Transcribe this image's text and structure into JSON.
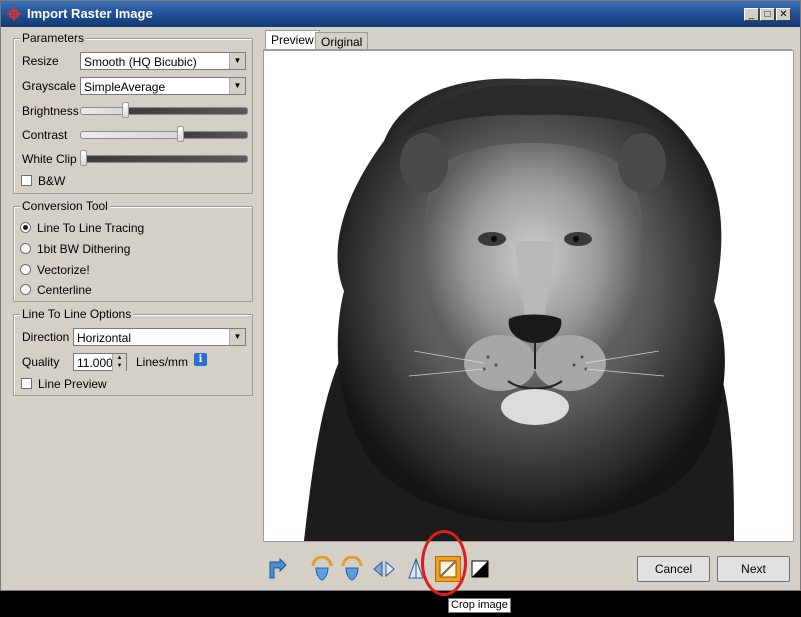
{
  "window": {
    "title": "Import Raster Image",
    "controls": [
      "_",
      "□",
      "✕"
    ]
  },
  "parameters": {
    "legend": "Parameters",
    "resize_label": "Resize",
    "resize_value": "Smooth (HQ Bicubic)",
    "grayscale_label": "Grayscale",
    "grayscale_value": "SimpleAverage",
    "brightness_label": "Brightness",
    "brightness_level": 0.26,
    "contrast_label": "Contrast",
    "contrast_level": 0.6,
    "whiteclip_label": "White Clip",
    "whiteclip_level": 0.0,
    "bw_label": "B&W",
    "bw_checked": false
  },
  "conversion": {
    "legend": "Conversion Tool",
    "options": [
      "Line To Line Tracing",
      "1bit BW Dithering",
      "Vectorize!",
      "Centerline"
    ],
    "selected_index": 0
  },
  "line_options": {
    "legend": "Line To Line Options",
    "direction_label": "Direction",
    "direction_value": "Horizontal",
    "quality_label": "Quality",
    "quality_value": "11.000",
    "quality_unit": "Lines/mm",
    "info_icon": "i",
    "line_preview_label": "Line Preview",
    "line_preview_checked": false
  },
  "tabs": [
    {
      "label": "Preview",
      "active": true
    },
    {
      "label": "Original",
      "active": false
    }
  ],
  "toolbar": {
    "icons": [
      "flip-icon",
      "rotate-left-icon",
      "rotate-right-icon",
      "mirror-horizontal-icon",
      "mirror-vertical-icon",
      "crop-icon",
      "invert-icon"
    ],
    "tooltip": "Crop image"
  },
  "buttons": {
    "cancel": "Cancel",
    "next": "Next"
  },
  "colors": {
    "titlebar": "#1d4a8f",
    "highlight_circle": "#e01b1b",
    "crop_button": "#f0a020"
  }
}
